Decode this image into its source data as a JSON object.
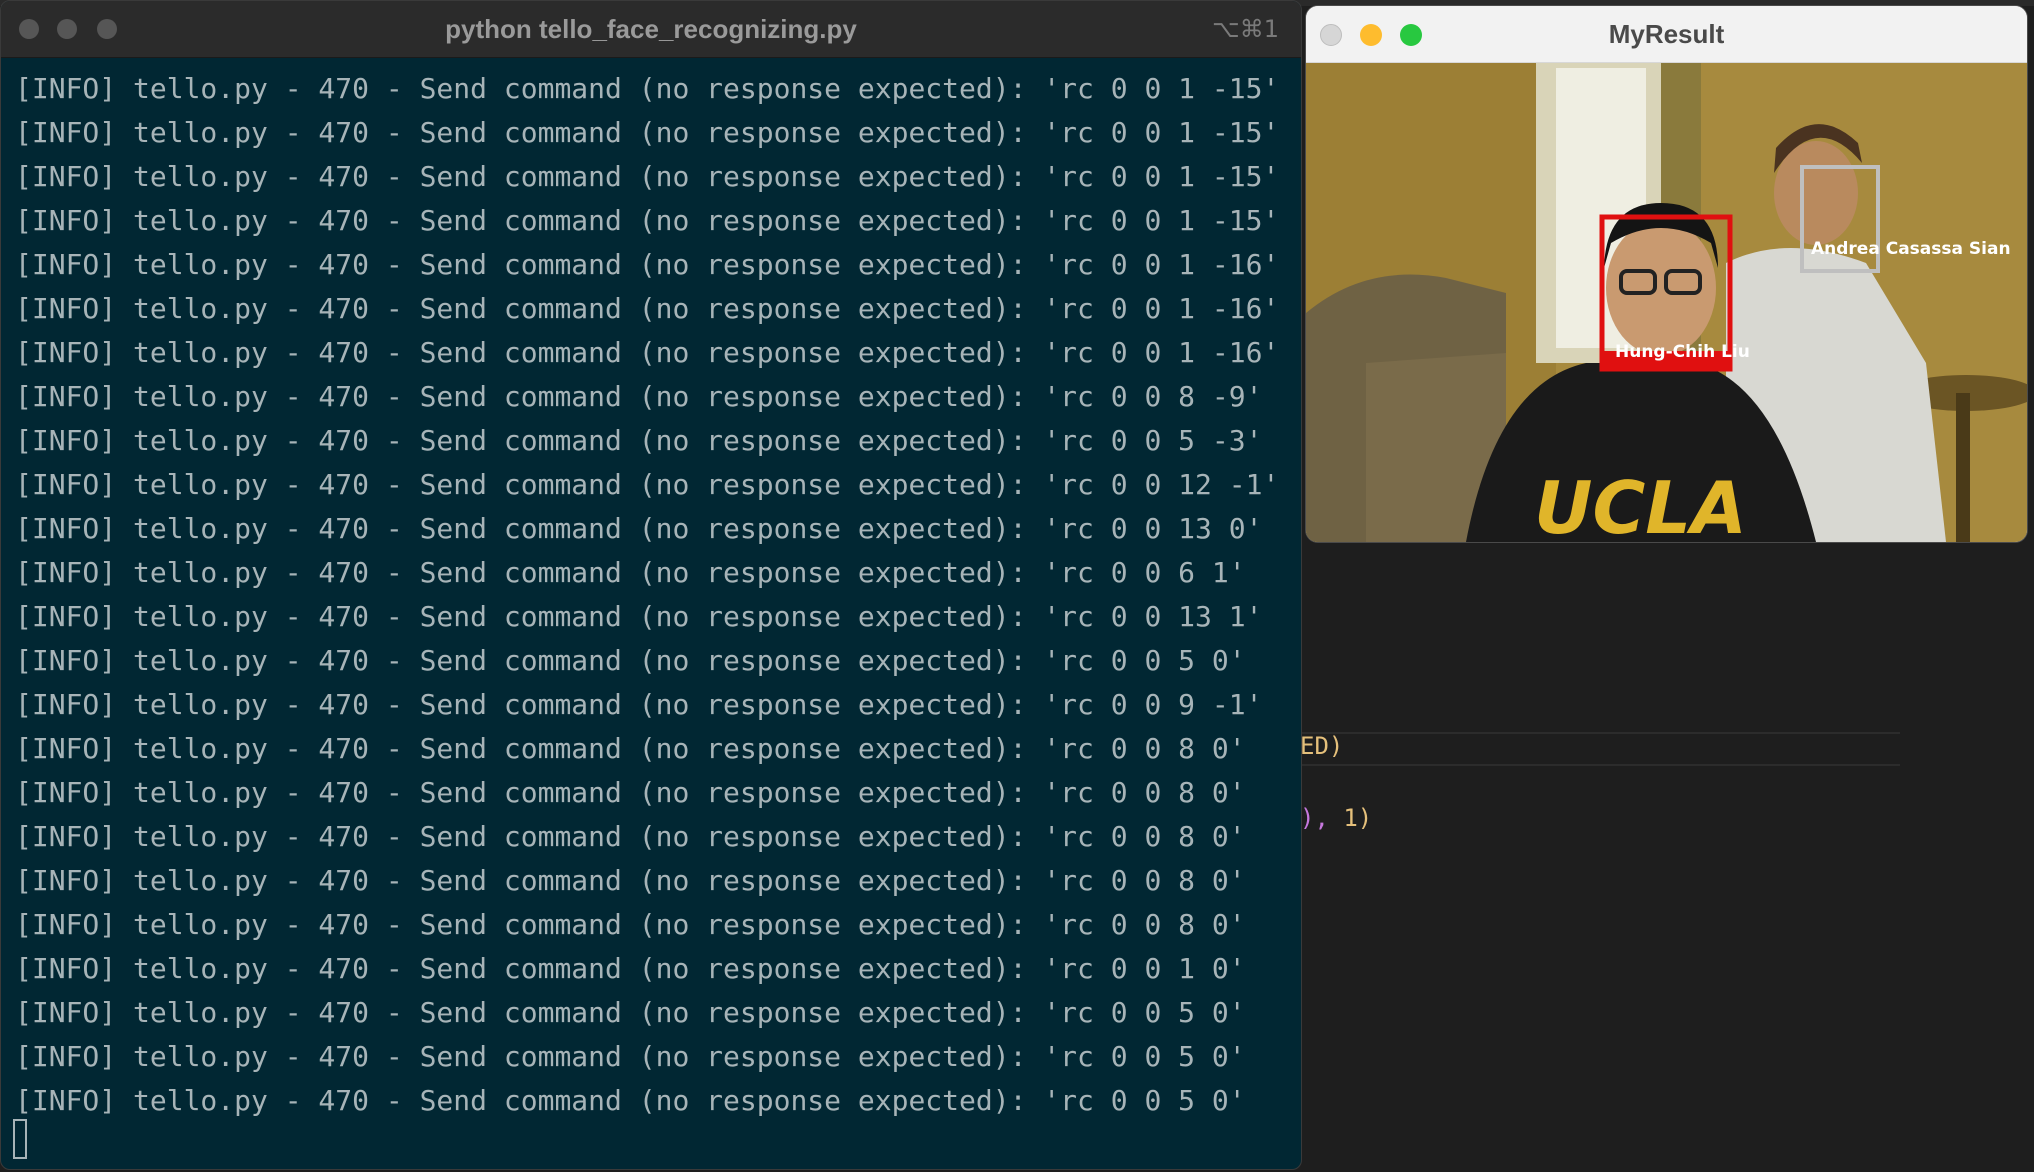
{
  "terminal": {
    "title": "python tello_face_recognizing.py",
    "shortcut": "⌥⌘1",
    "lines": [
      "[INFO] tello.py - 470 - Send command (no response expected): 'rc 0 0 1 -15'",
      "[INFO] tello.py - 470 - Send command (no response expected): 'rc 0 0 1 -15'",
      "[INFO] tello.py - 470 - Send command (no response expected): 'rc 0 0 1 -15'",
      "[INFO] tello.py - 470 - Send command (no response expected): 'rc 0 0 1 -15'",
      "[INFO] tello.py - 470 - Send command (no response expected): 'rc 0 0 1 -16'",
      "[INFO] tello.py - 470 - Send command (no response expected): 'rc 0 0 1 -16'",
      "[INFO] tello.py - 470 - Send command (no response expected): 'rc 0 0 1 -16'",
      "[INFO] tello.py - 470 - Send command (no response expected): 'rc 0 0 8 -9'",
      "[INFO] tello.py - 470 - Send command (no response expected): 'rc 0 0 5 -3'",
      "[INFO] tello.py - 470 - Send command (no response expected): 'rc 0 0 12 -1'",
      "[INFO] tello.py - 470 - Send command (no response expected): 'rc 0 0 13 0'",
      "[INFO] tello.py - 470 - Send command (no response expected): 'rc 0 0 6 1'",
      "[INFO] tello.py - 470 - Send command (no response expected): 'rc 0 0 13 1'",
      "[INFO] tello.py - 470 - Send command (no response expected): 'rc 0 0 5 0'",
      "[INFO] tello.py - 470 - Send command (no response expected): 'rc 0 0 9 -1'",
      "[INFO] tello.py - 470 - Send command (no response expected): 'rc 0 0 8 0'",
      "[INFO] tello.py - 470 - Send command (no response expected): 'rc 0 0 8 0'",
      "[INFO] tello.py - 470 - Send command (no response expected): 'rc 0 0 8 0'",
      "[INFO] tello.py - 470 - Send command (no response expected): 'rc 0 0 8 0'",
      "[INFO] tello.py - 470 - Send command (no response expected): 'rc 0 0 8 0'",
      "[INFO] tello.py - 470 - Send command (no response expected): 'rc 0 0 1 0'",
      "[INFO] tello.py - 470 - Send command (no response expected): 'rc 0 0 5 0'",
      "[INFO] tello.py - 470 - Send command (no response expected): 'rc 0 0 5 0'",
      "[INFO] tello.py - 470 - Send command (no response expected): 'rc 0 0 5 0'"
    ]
  },
  "viewer": {
    "title": "MyResult",
    "faces": [
      {
        "name": "Hung-Chih Liu",
        "box_color": "#e01010"
      },
      {
        "name": "Andrea Casassa Sian",
        "box_color": "#bfbfbf"
      }
    ],
    "shirt_text": "UCLA"
  },
  "editor": {
    "fragment_1": "ED)",
    "fragment_2_a": "),",
    "fragment_2_b": " 1)"
  },
  "colors": {
    "terminal_bg": "#012733",
    "terminal_text": "#a7b4b8",
    "close": "#ff5f57",
    "minimize": "#febc2e",
    "zoom": "#28c840"
  }
}
